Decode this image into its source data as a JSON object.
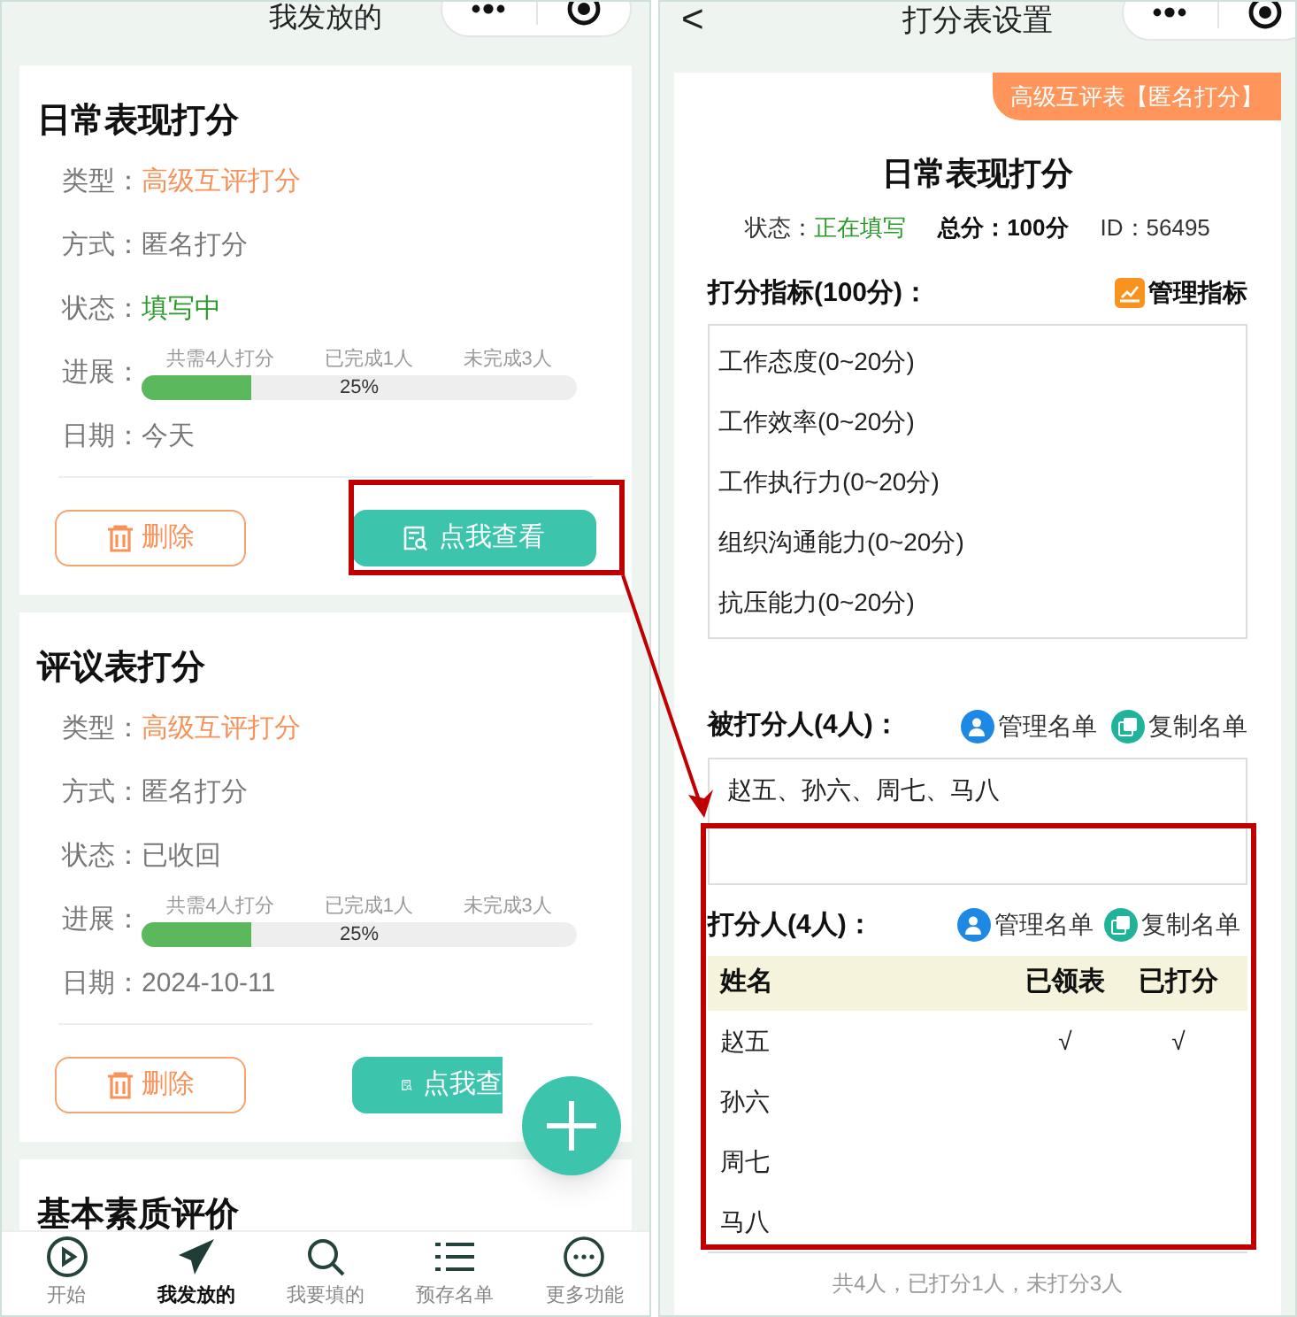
{
  "left_screen": {
    "header": {
      "title": "我发放的"
    },
    "cards": [
      {
        "title": "日常表现打分",
        "fields": [
          {
            "kind": "highlight",
            "label": "类型：",
            "value": "高级互评打分"
          },
          {
            "kind": "plain",
            "label": "方式：",
            "value": "匿名打分"
          },
          {
            "kind": "active",
            "label": "状态：",
            "value": "填写中"
          },
          {
            "kind": "progress",
            "label": "进展：",
            "notes": [
              "共需4人打分",
              "已完成1人",
              "未完成3人"
            ],
            "level": 0.25,
            "reading": "25%"
          },
          {
            "kind": "plain",
            "label": "日期：",
            "value": "今天"
          }
        ],
        "delete_button": "删除",
        "view_button": "点我查看"
      },
      {
        "title": "评议表打分",
        "fields": [
          {
            "kind": "highlight",
            "label": "类型：",
            "value": "高级互评打分"
          },
          {
            "kind": "plain",
            "label": "方式：",
            "value": "匿名打分"
          },
          {
            "kind": "plain",
            "label": "状态：",
            "value": "已收回"
          },
          {
            "kind": "progress",
            "label": "进展：",
            "notes": [
              "共需4人打分",
              "已完成1人",
              "未完成3人"
            ],
            "level": 0.25,
            "reading": "25%"
          },
          {
            "kind": "plain",
            "label": "日期：",
            "value": "2024-10-11"
          }
        ],
        "delete_button": "删除",
        "view_button": "点我查"
      },
      {
        "title": "基本素质评价"
      }
    ],
    "tabs": [
      {
        "kind": "play",
        "label": "开始",
        "selected": false
      },
      {
        "kind": "send",
        "label": "我发放的",
        "selected": true
      },
      {
        "kind": "search",
        "label": "我要填的",
        "selected": false
      },
      {
        "kind": "list",
        "label": "预存名单",
        "selected": false
      },
      {
        "kind": "more",
        "label": "更多功能",
        "selected": false
      }
    ]
  },
  "right_screen": {
    "header": {
      "back": "<",
      "title": "打分表设置"
    },
    "tag": "高级互评表【匿名打分】",
    "title": "日常表现打分",
    "meta": {
      "status_label": "状态：",
      "status": "正在填写",
      "total_label": "总分：",
      "total": "100分",
      "id_label": "ID：",
      "id": "56495"
    },
    "criteria": {
      "heading": "打分指标(100分)：",
      "manage_button": "管理指标",
      "items": [
        "工作态度(0~20分)",
        "工作效率(0~20分)",
        "工作执行力(0~20分)",
        "组织沟通能力(0~20分)",
        "抗压能力(0~20分)"
      ]
    },
    "ratees": {
      "heading": "被打分人(4人)：",
      "manage_button": "管理名单",
      "copy_button": "复制名单",
      "names": "赵五、孙六、周七、马八"
    },
    "raters": {
      "heading": "打分人(4人)：",
      "manage_button": "管理名单",
      "copy_button": "复制名单",
      "columns": [
        "姓名",
        "已领表",
        "已打分"
      ],
      "rows": [
        {
          "name": "赵五",
          "received": "√",
          "scored": "√"
        },
        {
          "name": "孙六"
        },
        {
          "name": "周七"
        },
        {
          "name": "马八"
        }
      ],
      "summary": "共4人，已打分1人，未打分3人"
    }
  }
}
